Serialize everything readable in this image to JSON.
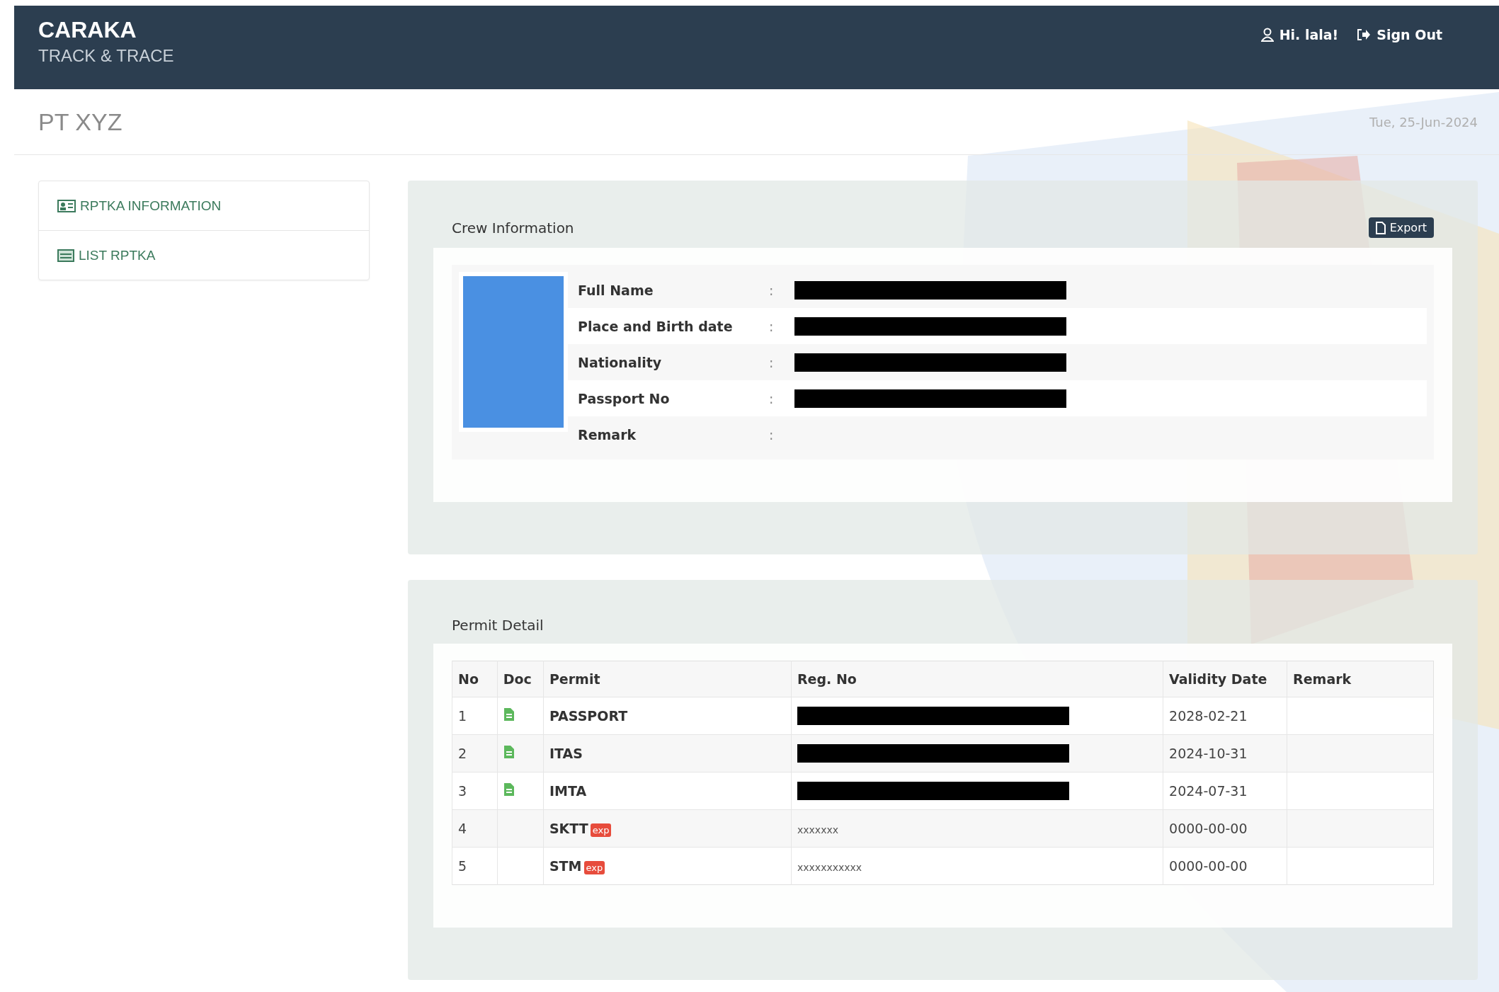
{
  "header": {
    "brand": "CARAKA",
    "subtitle": "TRACK & TRACE",
    "user": "Hi. lala!",
    "sign_out": "Sign Out"
  },
  "page": {
    "title": "PT XYZ",
    "date": "Tue, 25-Jun-2024"
  },
  "sidebar": {
    "items": [
      {
        "label": "RPTKA INFORMATION",
        "selected": false
      },
      {
        "label": "LIST RPTKA",
        "selected": false
      }
    ]
  },
  "crew": {
    "title": "Crew Information",
    "export": "Export",
    "fields": [
      {
        "label": "Full Name",
        "separator": ":",
        "redacted": true
      },
      {
        "label": "Place and Birth date",
        "separator": ":",
        "redacted": true
      },
      {
        "label": "Nationality",
        "separator": ":",
        "redacted": true
      },
      {
        "label": "Passport No",
        "separator": ":",
        "redacted": true
      },
      {
        "label": "Remark",
        "separator": ":",
        "redacted": false
      }
    ]
  },
  "permits": {
    "title": "Permit Detail",
    "columns": [
      "No",
      "Doc",
      "Permit",
      "Reg. No",
      "Validity Date",
      "Remark"
    ],
    "rows": [
      {
        "no": "1",
        "has_doc": true,
        "permit": "PASSPORT",
        "reg_redacted": true,
        "validity": "2028-02-21"
      },
      {
        "no": "2",
        "has_doc": true,
        "permit": "ITAS",
        "reg_redacted": true,
        "validity": "2024-10-31"
      },
      {
        "no": "3",
        "has_doc": true,
        "permit": "IMTA",
        "reg_redacted": true,
        "validity": "2024-07-31"
      },
      {
        "no": "4",
        "has_doc": false,
        "permit": "SKTT",
        "badge": "exp",
        "reg_no": "xxxxxxx",
        "reg_redacted": false,
        "validity": "0000-00-00"
      },
      {
        "no": "5",
        "has_doc": false,
        "permit": "STM",
        "badge": "exp",
        "reg_no": "xxxxxxxxxxx",
        "reg_redacted": false,
        "validity": "0000-00-00"
      }
    ]
  }
}
